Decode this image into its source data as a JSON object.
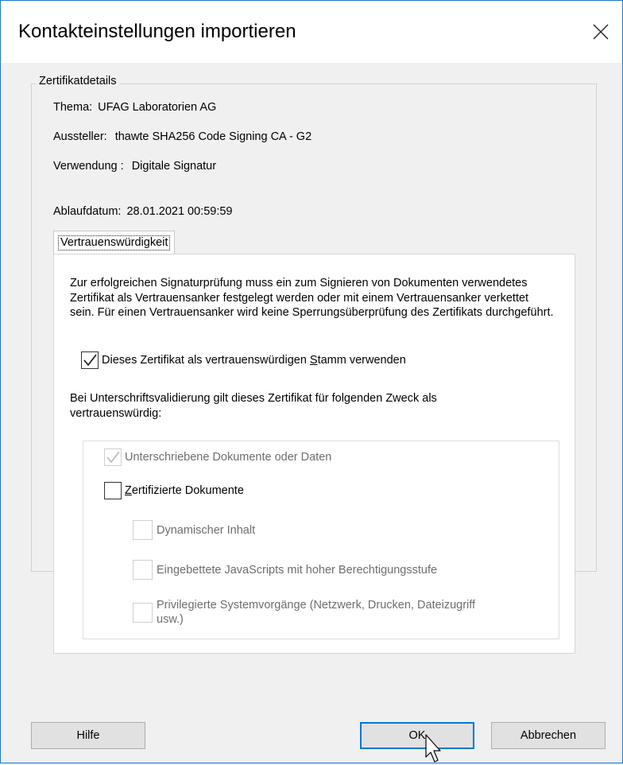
{
  "dialog": {
    "title": "Kontakteinstellungen importieren"
  },
  "certificate_details": {
    "group_label": "Zertifikatdetails",
    "subject_label": "Thema:",
    "subject_value": "UFAG Laboratorien AG",
    "issuer_label": "Aussteller:",
    "issuer_value": "thawte SHA256 Code Signing CA - G2",
    "usage_label": "Verwendung :",
    "usage_value": "Digitale Signatur",
    "expiry_label": "Ablaufdatum:",
    "expiry_value": "28.01.2021 00:59:59"
  },
  "trust_tab": {
    "tab_label": "Vertrauenswürdigkeit",
    "description": "Zur erfolgreichen Signaturprüfung muss ein zum Signieren von Dokumenten verwendetes Zertifikat als Vertrauensanker festgelegt werden oder mit einem Vertrauensanker verkettet sein. Für einen Vertrauensanker wird keine Sperrungsüberprüfung des Zertifikats durchgeführt.",
    "root_checkbox": {
      "label_pre": "Dieses Zertifikat als vertrauenswürdigen ",
      "label_accel": "S",
      "label_post": "tamm verwenden",
      "checked": true
    },
    "purpose_text": "Bei Unterschriftsvalidierung gilt dieses Zertifikat für folgenden Zweck als vertrauenswürdig:",
    "purposes": {
      "signed_documents": {
        "label": "Unterschriebene Dokumente oder Daten",
        "checked": true,
        "enabled": false
      },
      "certified_documents": {
        "label_accel": "Z",
        "label_post": "ertifizierte Dokumente",
        "checked": false,
        "enabled": true
      },
      "dynamic_content": {
        "label": "Dynamischer Inhalt",
        "checked": false,
        "enabled": false
      },
      "embedded_js": {
        "label": "Eingebettete JavaScripts mit hoher Berechtigungsstufe",
        "checked": false,
        "enabled": false
      },
      "system_ops": {
        "label_line1": "Privilegierte Systemvorgänge (Netzwerk, Drucken, Dateizugriff",
        "label_line2": "usw.)",
        "checked": false,
        "enabled": false
      }
    }
  },
  "buttons": {
    "help": "Hilfe",
    "ok": "OK",
    "cancel": "Abbrechen"
  },
  "icons": {
    "close": "close-icon",
    "check": "checkmark-icon",
    "cursor": "mouse-pointer-icon"
  }
}
